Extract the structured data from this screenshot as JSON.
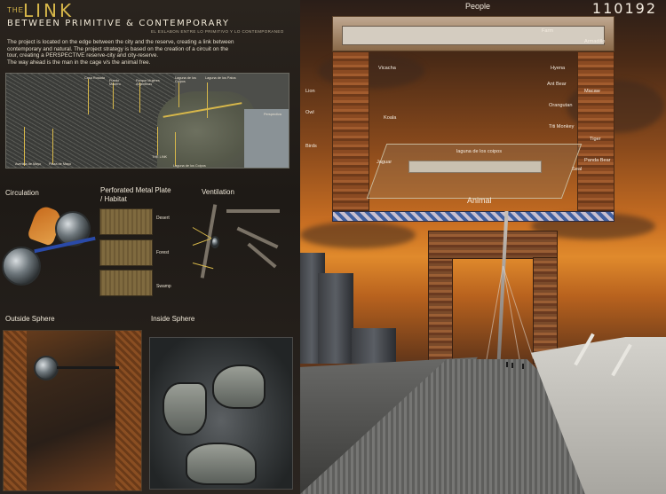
{
  "header": {
    "the": "THE",
    "link": "LINK",
    "subtitle": "BETWEEN PRIMITIVE & CONTEMPORARY",
    "spanish": "EL ESLABON ENTRE LO PRIMITIVO Y LO CONTEMPORANEO",
    "description": [
      "The project is located on the edge between the city and the reserve, creating a link between",
      "contemporary and natural. The project strategy is based on the creation of a circuit on the",
      "tour, creating a PERSPECTIVE reserve-city and city-reserve.",
      "The way ahead is the man in the cage v/s the animal free."
    ]
  },
  "map": {
    "labels": [
      "Casa Rosada",
      "Puerto Madero",
      "Parque Mujeres Argentinas",
      "Laguna de los Coipos",
      "Laguna de los Patos",
      "Perspectiva",
      "Avenida de Mayo",
      "Plaza de Mayo",
      "THE LINK",
      "Laguna de los Coipos"
    ]
  },
  "sections": {
    "circulation": "Circulation",
    "plate": "Perforated Metal Plate",
    "habitat": "/ Habitat",
    "ventilation": "Ventilation",
    "plate_levels": [
      "Desert",
      "Forest",
      "Swamp"
    ],
    "outside": "Outside Sphere",
    "inside": "Inside Sphere"
  },
  "render": {
    "code": "110192",
    "people": "People",
    "animal": "Animal",
    "left_animals": [
      "Vicacha",
      "Lion",
      "Owl",
      "Koala",
      "Birds",
      "Jaguar"
    ],
    "right_animals": [
      "Farm",
      "Armadillo",
      "Hyena",
      "Ant Bear",
      "Macaw",
      "Orangutan",
      "Titi Monkey",
      "Tiger",
      "Panda Bear",
      "Seal"
    ],
    "lagoon": "laguna de los coipos"
  }
}
